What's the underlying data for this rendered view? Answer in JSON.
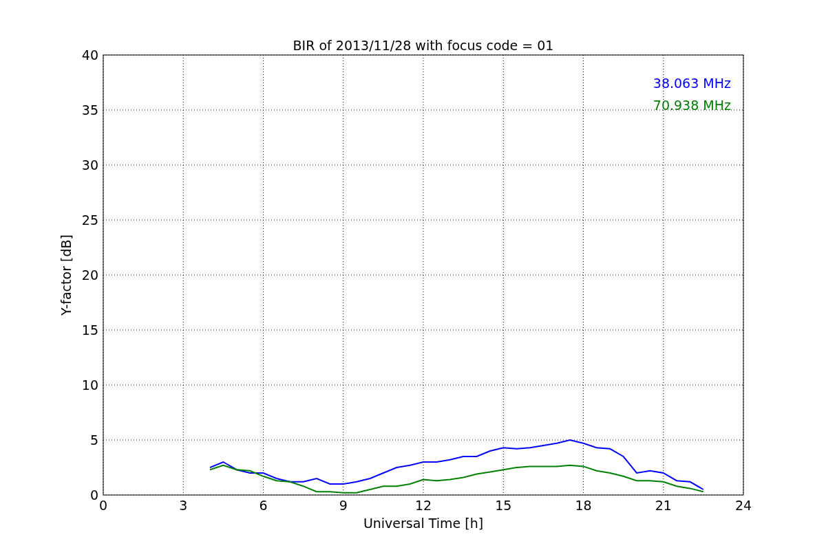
{
  "chart": {
    "chart_data": {
      "type": "line",
      "title": "BIR of 2013/11/28 with focus code = 01",
      "xlabel": "Universal Time [h]",
      "ylabel": "Y-factor [dB]",
      "x": [
        4,
        4.5,
        5,
        5.5,
        6,
        6.5,
        7,
        7.5,
        8,
        8.5,
        9,
        9.5,
        10,
        10.5,
        11,
        11.5,
        12,
        12.5,
        13,
        13.5,
        14,
        14.5,
        15,
        15.5,
        16,
        16.5,
        17,
        17.5,
        18,
        18.5,
        19,
        19.5,
        20,
        20.5,
        21,
        21.5,
        22,
        22.5
      ],
      "series": [
        {
          "name": "38.063 MHz",
          "color": "#0000ff",
          "values": [
            2.5,
            3,
            2.3,
            2,
            2,
            1.5,
            1.2,
            1.2,
            1.5,
            1,
            1,
            1.2,
            1.5,
            2,
            2.5,
            2.7,
            3,
            3,
            3.2,
            3.5,
            3.5,
            4,
            4.3,
            4.2,
            4.3,
            4.5,
            4.7,
            5,
            4.7,
            4.3,
            4.2,
            3.5,
            2,
            2.2,
            2,
            1.3,
            1.2,
            0.5
          ]
        },
        {
          "name": "70.938 MHz",
          "color": "#008000",
          "values": [
            2.3,
            2.7,
            2.3,
            2.2,
            1.7,
            1.3,
            1.2,
            0.8,
            0.3,
            0.3,
            0.2,
            0.2,
            0.5,
            0.8,
            0.8,
            1,
            1.4,
            1.3,
            1.4,
            1.6,
            1.9,
            2.1,
            2.3,
            2.5,
            2.6,
            2.6,
            2.6,
            2.7,
            2.6,
            2.2,
            2,
            1.7,
            1.3,
            1.3,
            1.2,
            0.8,
            0.6,
            0.3
          ]
        }
      ],
      "grid": true,
      "xlim": [
        0,
        24
      ],
      "ylim": [
        0,
        40
      ],
      "xticks": [
        0,
        3,
        6,
        9,
        12,
        15,
        18,
        21,
        24
      ],
      "yticks": [
        0,
        5,
        10,
        15,
        20,
        25,
        30,
        35,
        40
      ]
    }
  }
}
